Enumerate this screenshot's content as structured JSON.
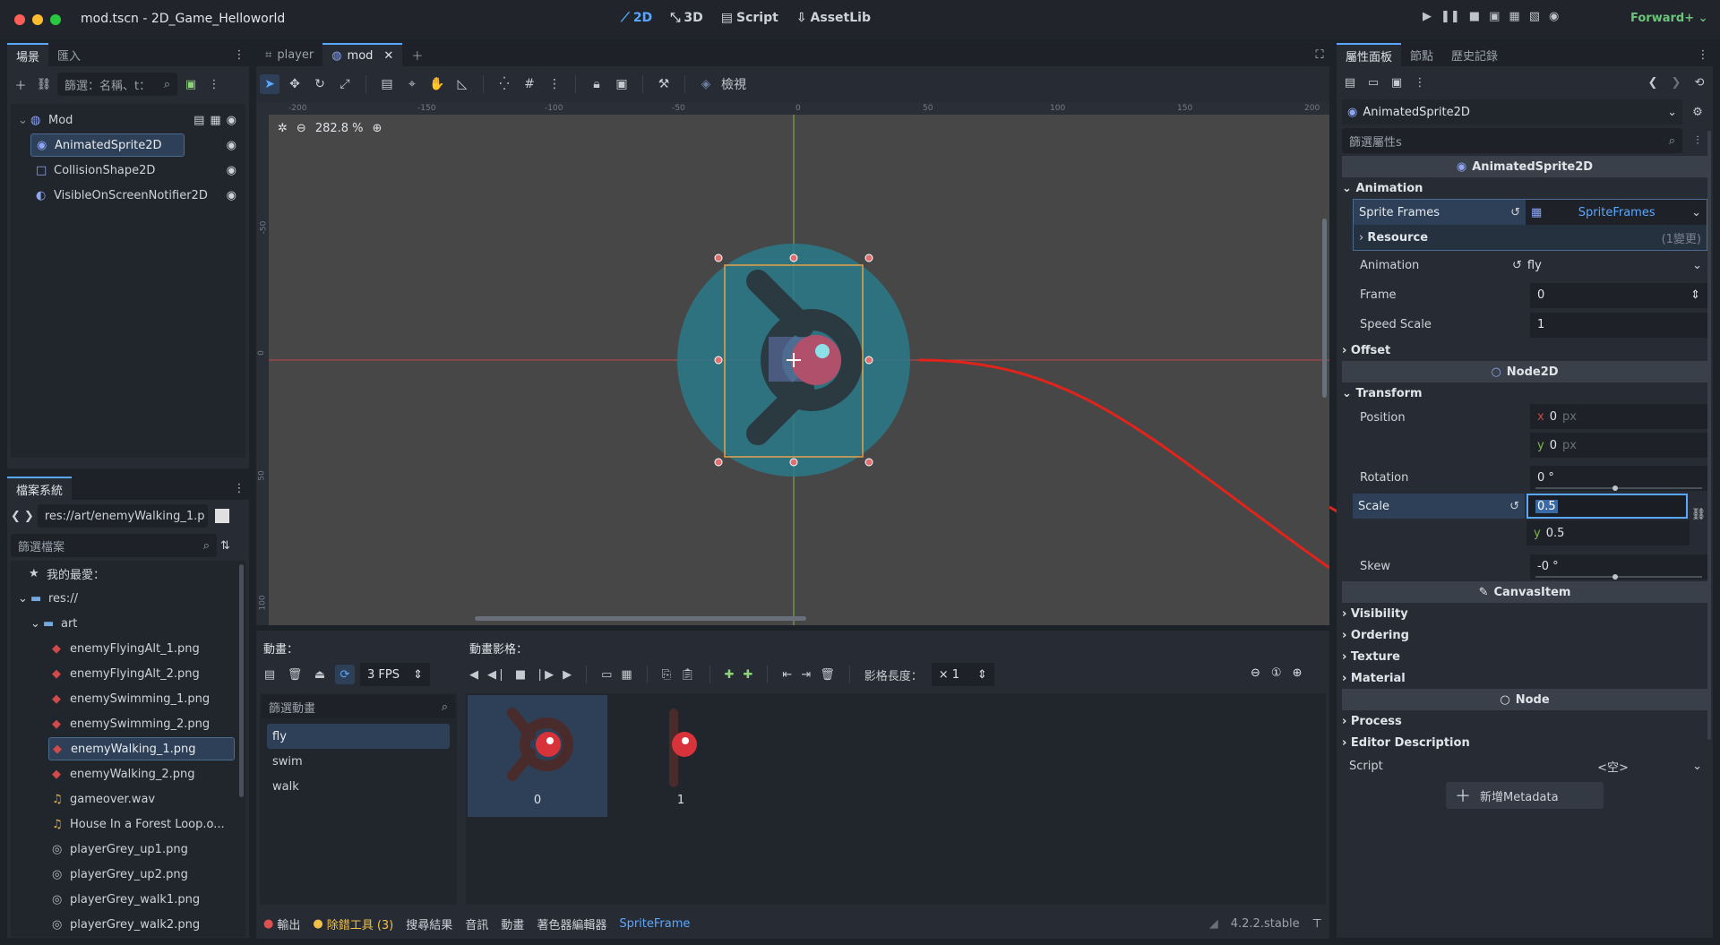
{
  "window": {
    "title": "mod.tscn - 2D_Game_Helloworld",
    "renderer": "Forward+"
  },
  "topbar": {
    "modes": [
      "2D",
      "3D",
      "Script",
      "AssetLib"
    ]
  },
  "scene_dock": {
    "tabs": [
      "場景",
      "匯入"
    ],
    "filter_placeholder": "篩選：名稱、t：",
    "nodes": [
      {
        "name": "Mod",
        "icon": "node2d-icon"
      },
      {
        "name": "AnimatedSprite2D",
        "icon": "animated-sprite-icon"
      },
      {
        "name": "CollisionShape2D",
        "icon": "collision-shape-icon"
      },
      {
        "name": "VisibleOnScreenNotifier2D",
        "icon": "notifier-icon"
      }
    ]
  },
  "filesystem": {
    "tab": "檔案系統",
    "path": "res://art/enemyWalking_1.p",
    "filter_placeholder": "篩選檔案",
    "items": [
      "我的最愛：",
      "res://",
      "art",
      "enemyFlyingAlt_1.png",
      "enemyFlyingAlt_2.png",
      "enemySwimming_1.png",
      "enemySwimming_2.png",
      "enemyWalking_1.png",
      "enemyWalking_2.png",
      "gameover.wav",
      "House In a Forest Loop.o...",
      "playerGrey_up1.png",
      "playerGrey_up2.png",
      "playerGrey_walk1.png",
      "playerGrey_walk2.png"
    ]
  },
  "editor_tabs": [
    "player",
    "mod"
  ],
  "toolbar2d": {
    "view_label": "檢視",
    "zoom": "282.8 %"
  },
  "ruler_h": [
    "-200",
    "-150",
    "-100",
    "-50",
    "0",
    "50",
    "100",
    "150",
    "200"
  ],
  "ruler_v": [
    "-50",
    "0",
    "50",
    "100"
  ],
  "spriteframes": {
    "anim_title": "動畫：",
    "frames_title": "動畫影格：",
    "fps": "3 FPS",
    "frame_length_label": "影格長度：",
    "frame_length_value": "× 1",
    "filter_placeholder": "篩選動畫",
    "animations": [
      "fly",
      "swim",
      "walk"
    ],
    "frames": [
      "0",
      "1"
    ]
  },
  "bottom_bar": {
    "tabs": [
      "輸出",
      "除錯工具 (3)",
      "搜尋結果",
      "音訊",
      "動畫",
      "著色器編輯器",
      "SpriteFrame"
    ],
    "version": "4.2.2.stable"
  },
  "inspector": {
    "tabs": [
      "屬性面板",
      "節點",
      "歷史記錄"
    ],
    "object": "AnimatedSprite2D",
    "filter_placeholder": "篩選屬性s",
    "class_header": "AnimatedSprite2D",
    "animation_cat": "Animation",
    "sprite_frames_label": "Sprite Frames",
    "sprite_frames_value": "SpriteFrames",
    "resource_label": "Resource",
    "resource_changes": "(1變更)",
    "animation_label": "Animation",
    "animation_value": "fly",
    "frame_label": "Frame",
    "frame_value": "0",
    "speed_label": "Speed Scale",
    "speed_value": "1",
    "offset_cat": "Offset",
    "node2d_header": "Node2D",
    "transform_cat": "Transform",
    "position_label": "Position",
    "pos_x": "0",
    "pos_y": "0",
    "px": "px",
    "rotation_label": "Rotation",
    "rotation_value": "0 °",
    "scale_label": "Scale",
    "scale_x": "0.5",
    "scale_y": "0.5",
    "skew_label": "Skew",
    "skew_value": "-0 °",
    "canvasitem_header": "CanvasItem",
    "canvas_cats": [
      "Visibility",
      "Ordering",
      "Texture",
      "Material"
    ],
    "node_header": "Node",
    "node_cats": [
      "Process",
      "Editor Description"
    ],
    "script_label": "Script",
    "script_value": "<空>",
    "add_metadata": "新增Metadata"
  },
  "colors": {
    "accent": "#5aa7ff",
    "selection": "#2e4057",
    "annotation_arrow": "#e0241b"
  }
}
